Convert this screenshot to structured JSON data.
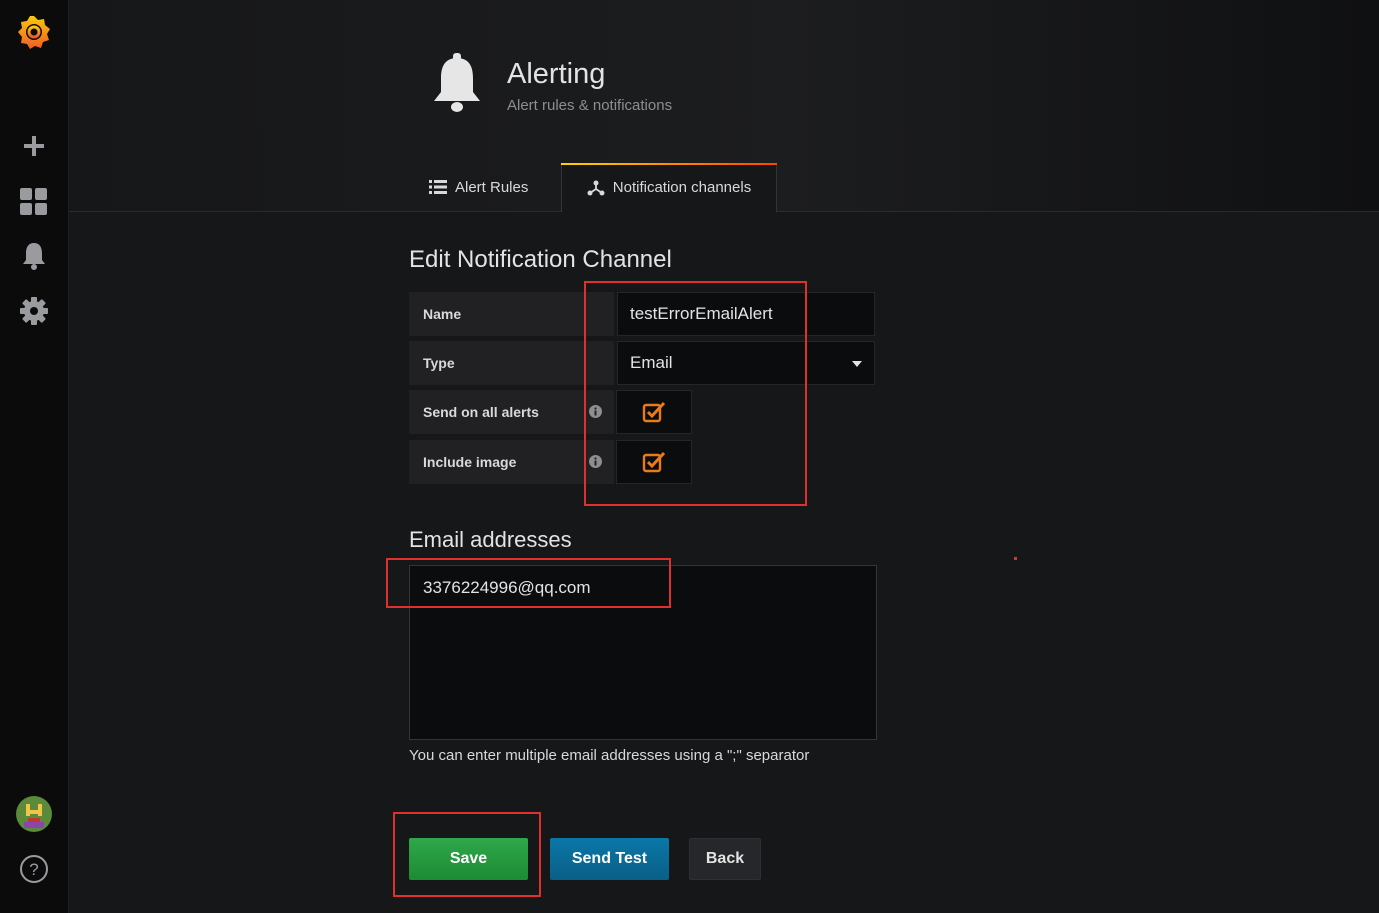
{
  "header": {
    "title": "Alerting",
    "subtitle": "Alert rules & notifications"
  },
  "tabs": [
    {
      "label": "Alert Rules",
      "active": false
    },
    {
      "label": "Notification channels",
      "active": true
    }
  ],
  "form": {
    "title": "Edit Notification Channel",
    "name_label": "Name",
    "name_value": "testErrorEmailAlert",
    "type_label": "Type",
    "type_value": "Email",
    "send_all_label": "Send on all alerts",
    "send_all_checked": true,
    "include_image_label": "Include image",
    "include_image_checked": true
  },
  "email": {
    "section_title": "Email addresses",
    "value": "3376224996@qq.com",
    "help": "You can enter multiple email addresses using a \";\" separator"
  },
  "buttons": {
    "save": "Save",
    "send_test": "Send Test",
    "back": "Back"
  },
  "colors": {
    "accent": "#eb7b18",
    "save": "#299c46",
    "send_test": "#0a6a97",
    "highlight": "#e02f2f"
  }
}
